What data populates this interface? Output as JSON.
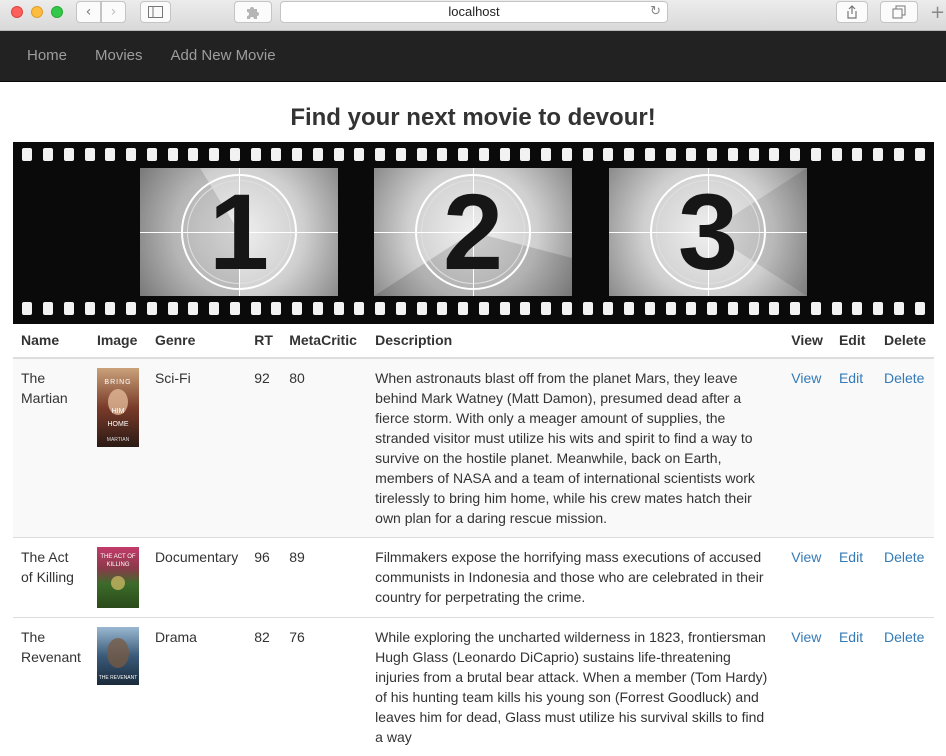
{
  "browser": {
    "url": "localhost"
  },
  "nav": {
    "items": [
      "Home",
      "Movies",
      "Add New Movie"
    ]
  },
  "page": {
    "heading": "Find your next movie to devour!"
  },
  "banner": {
    "numbers": [
      "1",
      "2",
      "3"
    ]
  },
  "table": {
    "headers": [
      "Name",
      "Image",
      "Genre",
      "RT",
      "MetaCritic",
      "Description",
      "View",
      "Edit",
      "Delete"
    ],
    "rows": [
      {
        "name": "The Martian",
        "poster_color": "#7a3b2a",
        "poster_text": "BRING HIM HOME",
        "genre": "Sci-Fi",
        "rt": "92",
        "meta": "80",
        "description": "When astronauts blast off from the planet Mars, they leave behind Mark Watney (Matt Damon), presumed dead after a fierce storm. With only a meager amount of supplies, the stranded visitor must utilize his wits and spirit to find a way to survive on the hostile planet. Meanwhile, back on Earth, members of NASA and a team of international scientists work tirelessly to bring him home, while his crew mates hatch their own plan for a daring rescue mission.",
        "view": "View",
        "edit": "Edit",
        "delete": "Delete"
      },
      {
        "name": "The Act of Killing",
        "poster_color": "#3d6b2a",
        "poster_text": "THE ACT OF KILLING",
        "genre": "Documentary",
        "rt": "96",
        "meta": "89",
        "description": "Filmmakers expose the horrifying mass executions of accused communists in Indonesia and those who are celebrated in their country for perpetrating the crime.",
        "view": "View",
        "edit": "Edit",
        "delete": "Delete"
      },
      {
        "name": "The Revenant",
        "poster_color": "#3a5a7a",
        "poster_text": "THE REVENANT",
        "genre": "Drama",
        "rt": "82",
        "meta": "76",
        "description": "While exploring the uncharted wilderness in 1823, frontiersman Hugh Glass (Leonardo DiCaprio) sustains life-threatening injuries from a brutal bear attack. When a member (Tom Hardy) of his hunting team kills his young son (Forrest Goodluck) and leaves him for dead, Glass must utilize his survival skills to find a way",
        "view": "View",
        "edit": "Edit",
        "delete": "Delete"
      }
    ]
  }
}
